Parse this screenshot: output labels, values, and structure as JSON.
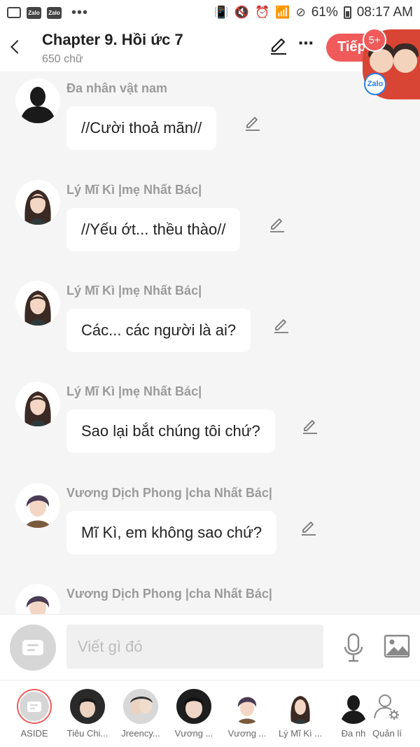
{
  "status_bar": {
    "battery": "61%",
    "time": "08:17 AM",
    "notification_icons": [
      "image-icon",
      "zalo-icon",
      "zalo-icon"
    ],
    "more": "•••"
  },
  "header": {
    "title": "Chapter 9. Hồi ức 7",
    "word_count": "650 chữ",
    "next_label": "Tiếp",
    "zalo_badge": "5+",
    "zalo_label": "Zalo"
  },
  "messages": [
    {
      "speaker": "Đa nhân vật nam",
      "text": "//Cười thoả mãn//",
      "avatar": "silhouette"
    },
    {
      "speaker": "Lý Mĩ Kì |mẹ Nhất Bác|",
      "text": "//Yếu ớt... thều thào//",
      "avatar": "woman"
    },
    {
      "speaker": "Lý Mĩ Kì |mẹ Nhất Bác|",
      "text": "Các... các người là ai?",
      "avatar": "woman"
    },
    {
      "speaker": "Lý Mĩ Kì |mẹ Nhất Bác|",
      "text": "Sao lại bắt chúng tôi chứ?",
      "avatar": "woman"
    },
    {
      "speaker": "Vương Dịch Phong |cha Nhất Bác|",
      "text": "Mĩ Kì, em không sao chứ?",
      "avatar": "man"
    },
    {
      "speaker": "Vương Dịch Phong |cha Nhất Bác|",
      "text": "",
      "avatar": "man"
    }
  ],
  "input": {
    "placeholder": "Viết gì đó"
  },
  "characters": [
    {
      "name": "ASIDE"
    },
    {
      "name": "Tiêu Chi..."
    },
    {
      "name": "Jreency..."
    },
    {
      "name": "Vương ..."
    },
    {
      "name": "Vương ..."
    },
    {
      "name": "Lý Mĩ Kì ..."
    },
    {
      "name": "Đa nh"
    },
    {
      "name": "Quản lí"
    }
  ],
  "colors": {
    "accent": "#f05a5a",
    "background": "#f5f5f5",
    "speaker": "#9b9b9b",
    "zalo": "#2a7de1"
  }
}
